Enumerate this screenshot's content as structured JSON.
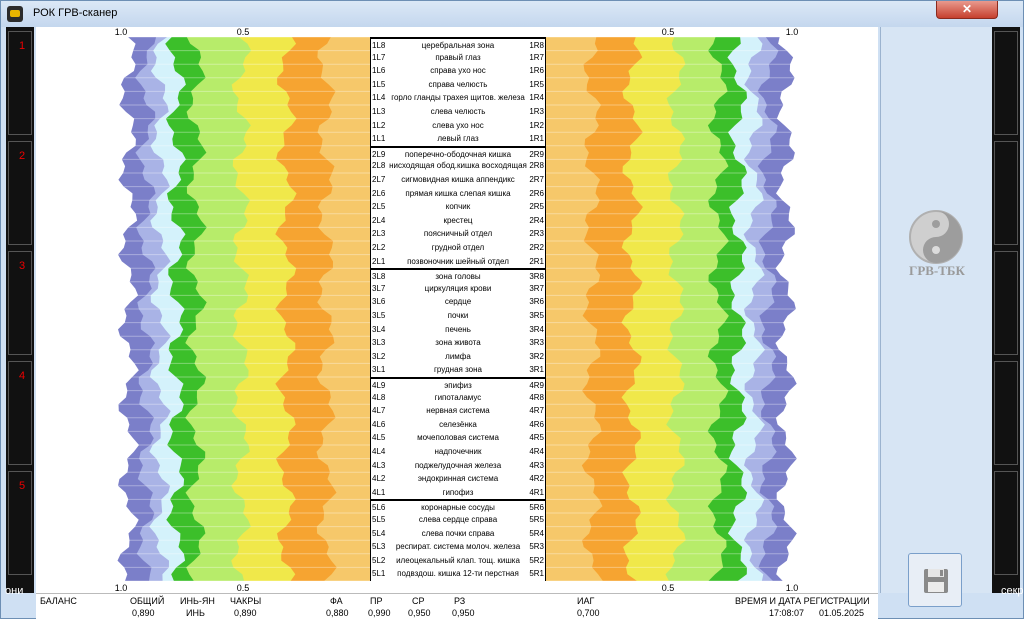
{
  "window": {
    "title": "РОК ГРВ-сканер",
    "close": "✕"
  },
  "left_strip": {
    "numbers": [
      "1",
      "2",
      "3",
      "4",
      "5"
    ]
  },
  "desktop": {
    "left_text": "они",
    "right_text": "секр"
  },
  "axis": {
    "left_labels": [
      "1.0",
      "0.5"
    ],
    "right_labels": [
      "0.5",
      "1.0"
    ]
  },
  "rows": [
    {
      "l": "1L8",
      "name": "церебральная зона",
      "r": "1R8",
      "grp": true
    },
    {
      "l": "1L7",
      "name": "правый глаз",
      "r": "1R7"
    },
    {
      "l": "1L6",
      "name": "справа ухо  нос",
      "r": "1R6"
    },
    {
      "l": "1L5",
      "name": "справа челюсть",
      "r": "1R5"
    },
    {
      "l": "1L4",
      "name": "горло гланды трахея щитов. железа",
      "r": "1R4"
    },
    {
      "l": "1L3",
      "name": "слева челюсть",
      "r": "1R3"
    },
    {
      "l": "1L2",
      "name": "слева ухо  нос",
      "r": "1R2"
    },
    {
      "l": "1L1",
      "name": "левый глаз",
      "r": "1R1"
    },
    {
      "l": "2L9",
      "name": "поперечно-ободочная кишка",
      "r": "2R9",
      "grp": true
    },
    {
      "l": "2L8",
      "name": "нисходящая обод.кишка восходящая",
      "r": "2R8"
    },
    {
      "l": "2L7",
      "name": "сигмовидная кишка   аппендикс",
      "r": "2R7"
    },
    {
      "l": "2L6",
      "name": "прямая кишка    слепая кишка",
      "r": "2R6"
    },
    {
      "l": "2L5",
      "name": "копчик",
      "r": "2R5"
    },
    {
      "l": "2L4",
      "name": "крестец",
      "r": "2R4"
    },
    {
      "l": "2L3",
      "name": "поясничный отдел",
      "r": "2R3"
    },
    {
      "l": "2L2",
      "name": "грудной отдел",
      "r": "2R2"
    },
    {
      "l": "2L1",
      "name": "позвоночник шейный отдел",
      "r": "2R1"
    },
    {
      "l": "3L8",
      "name": "зона головы",
      "r": "3R8",
      "grp": true
    },
    {
      "l": "3L7",
      "name": "циркуляция крови",
      "r": "3R7"
    },
    {
      "l": "3L6",
      "name": "сердце",
      "r": "3R6"
    },
    {
      "l": "3L5",
      "name": "почки",
      "r": "3R5"
    },
    {
      "l": "3L4",
      "name": "печень",
      "r": "3R4"
    },
    {
      "l": "3L3",
      "name": "зона живота",
      "r": "3R3"
    },
    {
      "l": "3L2",
      "name": "лимфа",
      "r": "3R2"
    },
    {
      "l": "3L1",
      "name": "грудная зона",
      "r": "3R1"
    },
    {
      "l": "4L9",
      "name": "эпифиз",
      "r": "4R9",
      "grp": true
    },
    {
      "l": "4L8",
      "name": "гипоталамус",
      "r": "4R8"
    },
    {
      "l": "4L7",
      "name": "нервная система",
      "r": "4R7"
    },
    {
      "l": "4L6",
      "name": "селезёнка",
      "r": "4R6"
    },
    {
      "l": "4L5",
      "name": "мочеполовая система",
      "r": "4R5"
    },
    {
      "l": "4L4",
      "name": "надпочечник",
      "r": "4R4"
    },
    {
      "l": "4L3",
      "name": "поджелудочная железа",
      "r": "4R3"
    },
    {
      "l": "4L2",
      "name": "эндокринная система",
      "r": "4R2"
    },
    {
      "l": "4L1",
      "name": "гипофиз",
      "r": "4R1"
    },
    {
      "l": "5L6",
      "name": "коронарные сосуды",
      "r": "5R6",
      "grp": true
    },
    {
      "l": "5L5",
      "name": "слева       сердце       справа",
      "r": "5R5"
    },
    {
      "l": "5L4",
      "name": "слева        почки       справа",
      "r": "5R4"
    },
    {
      "l": "5L3",
      "name": "респират. система молоч. железа",
      "r": "5R3"
    },
    {
      "l": "5L2",
      "name": "илеоцекальный клап.  тощ. кишка",
      "r": "5R2"
    },
    {
      "l": "5L1",
      "name": "подвздош. кишка 12-ти перстная",
      "r": "5R1"
    }
  ],
  "side": {
    "logo_text": "ГРВ-ТБК",
    "save_icon": "floppy-disk-icon"
  },
  "status": {
    "balance_label": "БАЛАНС",
    "total_label": "ОБЩИЙ",
    "total_value": "0,890",
    "yinyang_label": "ИНЬ-ЯН",
    "yinyang_value": "ИНЬ",
    "chakras_label": "ЧАКРЫ",
    "chakras_value": "0,890",
    "fa_label": "ФА",
    "fa_value": "0,880",
    "pr_label": "ПР",
    "pr_value": "0,990",
    "sr_label": "СР",
    "sr_value": "0,950",
    "rz_label": "РЗ",
    "rz_value": "0,950",
    "iag_label": "ИАГ",
    "iag_value": "0,700",
    "datetime_label": "ВРЕМЯ И ДАТА РЕГИСТРАЦИИ",
    "time_value": "17:08:07",
    "date_value": "01.05.2025"
  }
}
